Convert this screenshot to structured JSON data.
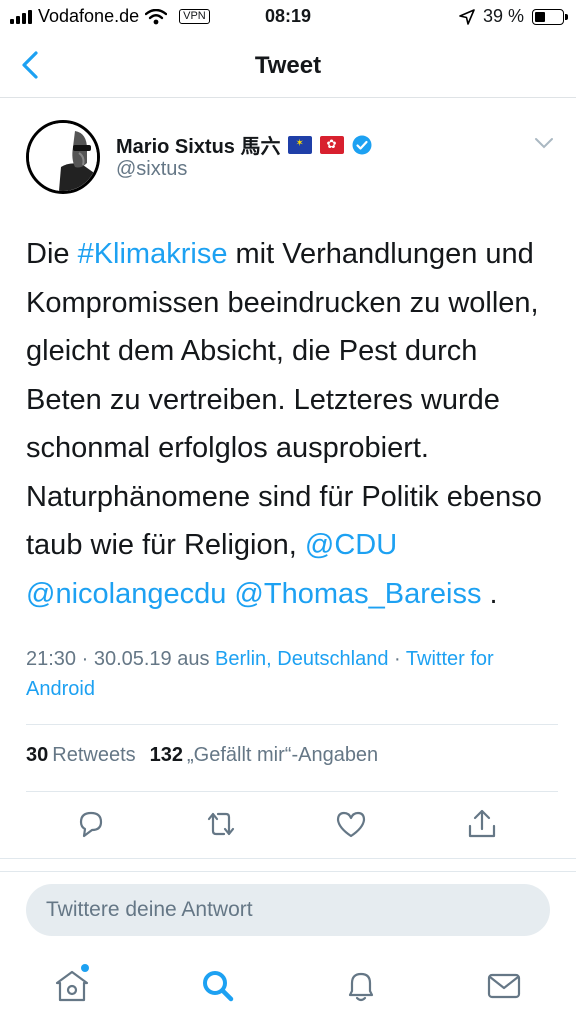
{
  "status_bar": {
    "carrier": "Vodafone.de",
    "vpn": "VPN",
    "time": "08:19",
    "battery_text": "39 %",
    "battery_level": 0.39
  },
  "nav": {
    "title": "Tweet"
  },
  "author": {
    "name": "Mario Sixtus 馬六",
    "handle": "@sixtus"
  },
  "tweet": {
    "segments": [
      {
        "t": "Die ",
        "link": false
      },
      {
        "t": "#Klimakrise",
        "link": true
      },
      {
        "t": " mit Verhandlungen und Kompromissen beeindrucken zu wollen, gleicht dem Absicht, die Pest durch Beten zu vertreiben. Letzteres wurde schonmal erfolglos ausprobiert. Naturphänomene sind für Politik ebenso taub wie für Religion, ",
        "link": false
      },
      {
        "t": "@CDU",
        "link": true
      },
      {
        "t": " ",
        "link": false
      },
      {
        "t": "@nicolangecdu",
        "link": true
      },
      {
        "t": " ",
        "link": false
      },
      {
        "t": "@Thomas_Bareiss",
        "link": true
      },
      {
        "t": " .",
        "link": false
      }
    ]
  },
  "meta": {
    "time": "21:30 · 30.05.19 aus ",
    "location": "Berlin, Deutschland",
    "sep": " · ",
    "source": "Twitter for Android"
  },
  "stats": {
    "retweets_count": "30",
    "retweets_label": "Retweets",
    "likes_count": "132",
    "likes_label": "„Gefällt mir“-Angaben"
  },
  "reply": {
    "placeholder": "Twittere deine Antwort"
  },
  "colors": {
    "link": "#1da1f2",
    "muted": "#657786",
    "text": "#14171a"
  }
}
